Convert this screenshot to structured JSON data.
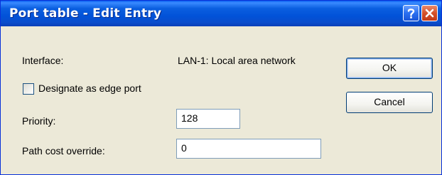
{
  "window": {
    "title": "Port table - Edit Entry"
  },
  "titlebar_buttons": {
    "help_icon": "question-mark-icon",
    "close_icon": "close-x-icon"
  },
  "form": {
    "interface_label": "Interface:",
    "interface_value": "LAN-1: Local area network",
    "edge_port_label": "Designate as edge port",
    "edge_port_checked": false,
    "priority_label": "Priority:",
    "priority_value": "128",
    "path_cost_label": "Path cost override:",
    "path_cost_value": "0"
  },
  "buttons": {
    "ok_label": "OK",
    "cancel_label": "Cancel"
  },
  "colors": {
    "titlebar": "#0152d8",
    "dialog_bg": "#ece9d8",
    "close_button": "#d4512a"
  }
}
